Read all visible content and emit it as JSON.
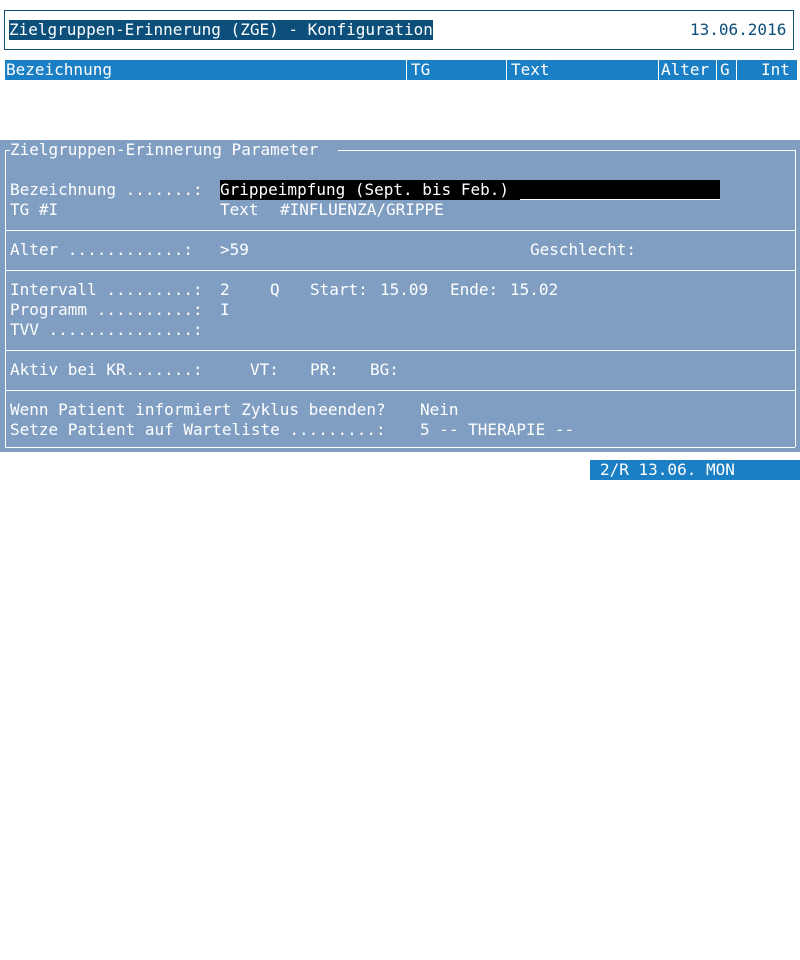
{
  "header": {
    "title": "Zielgruppen-Erinnerung (ZGE) - Konfiguration",
    "date": "13.06.2016"
  },
  "columns": [
    "Bezeichnung",
    "TG",
    "Text",
    "Alter",
    "G",
    "Int"
  ],
  "panel": {
    "title": "Zielgruppen-Erinnerung Parameter",
    "bezeichnung_label": "Bezeichnung .......:",
    "bezeichnung_value": "Grippeimpfung (Sept. bis Feb.)",
    "tg_label": "TG #I",
    "text_label": "Text",
    "text_value": "#INFLUENZA/GRIPPE",
    "alter_label": "Alter ............:",
    "alter_value": ">59",
    "geschlecht_label": "Geschlecht:",
    "intervall_label": "Intervall .........:",
    "intervall_value": "2",
    "intervall_unit": "Q",
    "start_label": "Start:",
    "start_value": "15.09",
    "ende_label": "Ende:",
    "ende_value": "15.02",
    "programm_label": "Programm ..........:",
    "programm_value": "I",
    "tvv_label": "TVV ...............:",
    "aktiv_label": "Aktiv bei KR.......:",
    "vt_label": "VT:",
    "pr_label": "PR:",
    "bg_label": "BG:",
    "zyklus_label": "Wenn Patient informiert Zyklus beenden?",
    "zyklus_value": "Nein",
    "warteliste_label": "Setze Patient auf Warteliste .........:",
    "warteliste_value": "5 -- THERAPIE --"
  },
  "status": {
    "text": "2/R 13.06. MON"
  },
  "colors": {
    "dark_blue": "#0b4f7a",
    "header_blue": "#1a7fc4",
    "panel_blue": "#7f9ec2"
  }
}
